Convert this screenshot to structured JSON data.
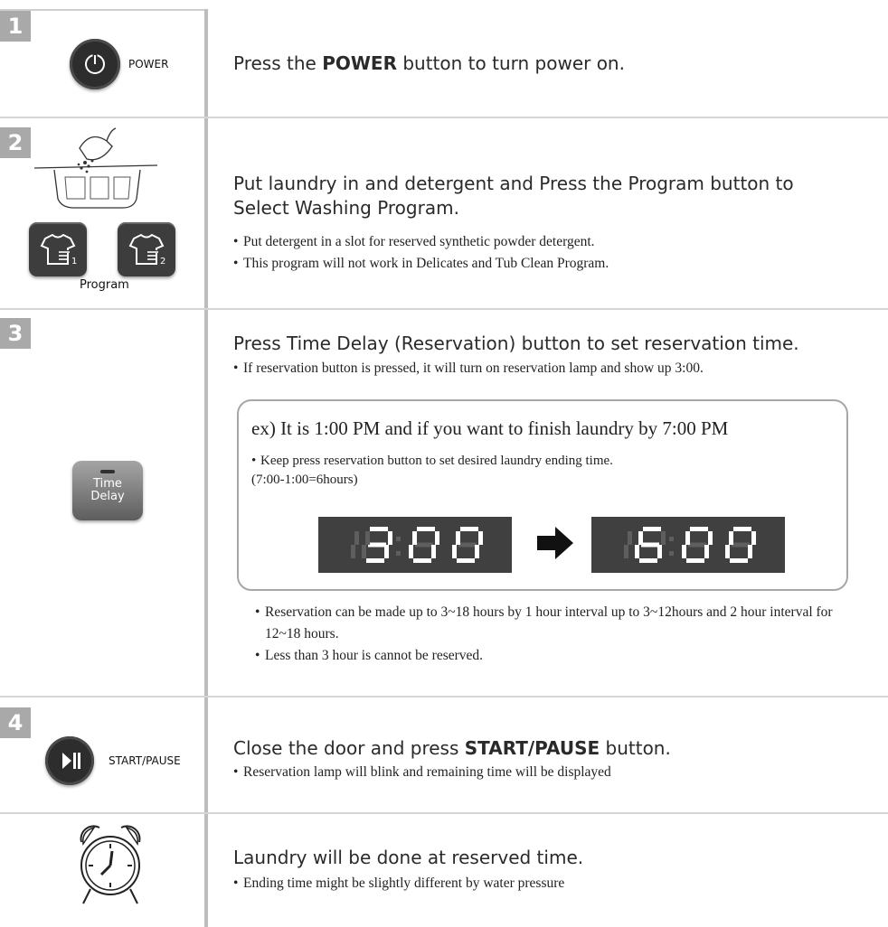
{
  "step1": {
    "number": "1",
    "button_label": "POWER",
    "text_before": "Press the ",
    "text_bold": "POWER",
    "text_after": " button to turn power on."
  },
  "step2": {
    "number": "2",
    "button_label": "Program",
    "heading": "Put laundry in and detergent and Press the Program button to Select Washing Program.",
    "bullets": [
      "Put detergent in a slot for reserved synthetic powder detergent.",
      "This program will not work in Delicates and Tub Clean Program."
    ]
  },
  "step3": {
    "number": "3",
    "button_line1": "Time",
    "button_line2": "Delay",
    "heading": "Press Time Delay (Reservation) button to set reservation time.",
    "bullet": "If reservation button is pressed, it will turn on reservation lamp and show up  3:00.",
    "example": {
      "title": "ex) It is 1:00 PM and if you want to finish laundry by  7:00 PM",
      "bullet_line1": "Keep press reservation button to set desired laundry ending time.",
      "bullet_line2": "(7:00-1:00=6hours)",
      "display_from": "3:00",
      "display_to": "6:00",
      "display_color": "#ffffff",
      "display_ghost_color": "#5e5e5e"
    },
    "notes": [
      "Reservation can be made up to 3~18 hours by 1 hour interval up to 3~12hours and 2 hour interval for 12~18 hours.",
      "Less than 3 hour is cannot be reserved."
    ]
  },
  "step4": {
    "number": "4",
    "button_label": "START/PAUSE",
    "text_before": "Close the door and press ",
    "text_bold": "START/PAUSE",
    "text_after": " button.",
    "bullet": "Reservation lamp will blink and remaining time will be displayed"
  },
  "step5": {
    "icon": "alarm-clock-icon",
    "heading": "Laundry will be done at reserved time.",
    "bullet": "Ending time might be slightly different by water pressure"
  },
  "colors": {
    "number_badge": "#a9a9a9",
    "divider": "#d5d5d5",
    "button_dark": "#2d2d2d"
  }
}
